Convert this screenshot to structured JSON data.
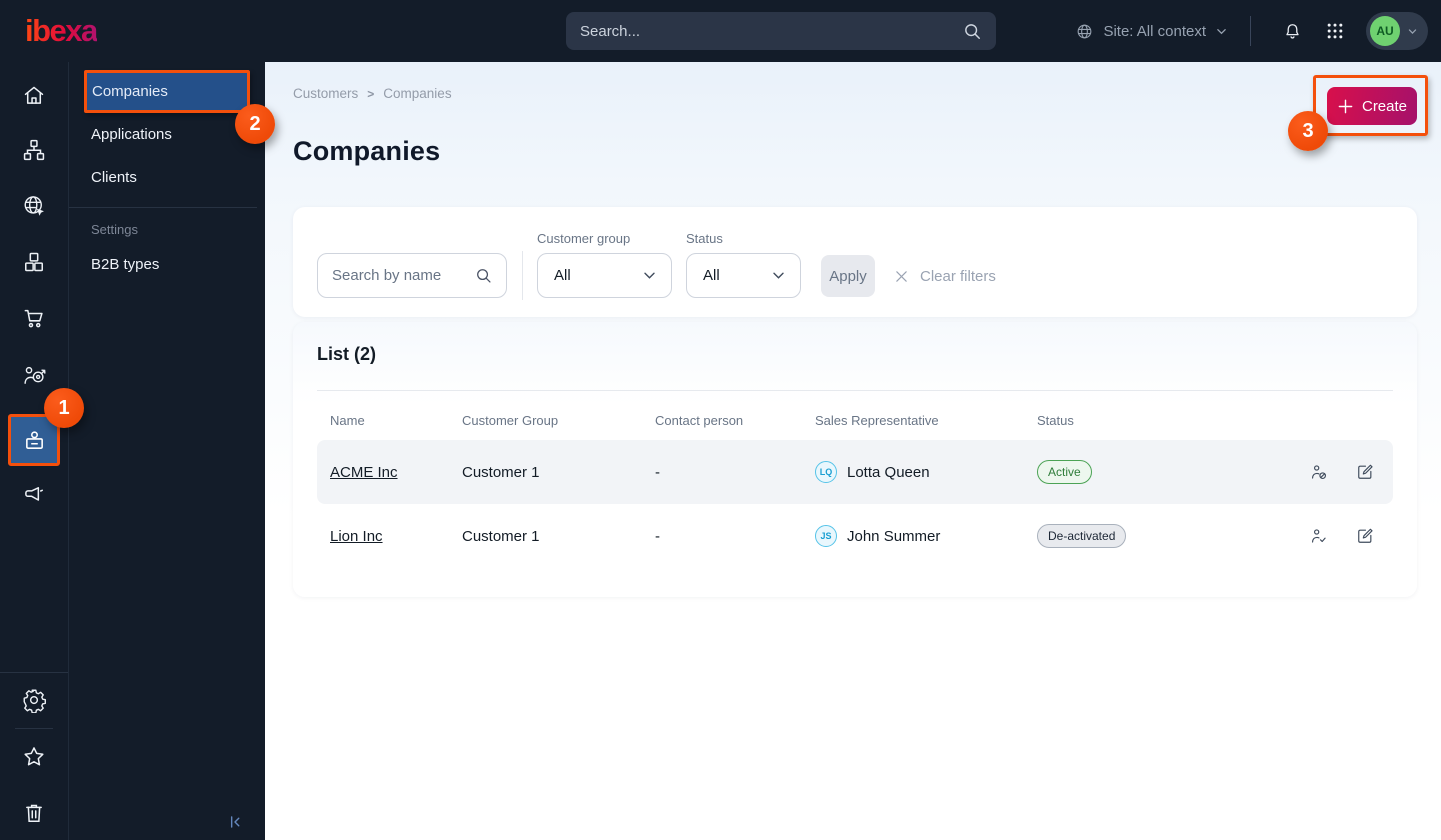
{
  "colors": {
    "topbar_bg": "#131c29",
    "annotation_orange": "#f4500c",
    "selected_menu_blue": "#24508a",
    "brand_gradient_start": "#d8104b",
    "brand_gradient_end": "#a5116b",
    "active_badge_green": "#2f7d3a",
    "avatar_green": "#6fd170"
  },
  "topbar": {
    "logo_text": "ibexa",
    "search_placeholder": "Search...",
    "site_context_label": "Site: All context",
    "avatar_initials": "AU"
  },
  "sidebar": {
    "menu_items": [
      {
        "label": "Companies"
      },
      {
        "label": "Applications"
      },
      {
        "label": "Clients"
      }
    ],
    "section_label": "Settings",
    "section_items": [
      {
        "label": "B2B types"
      }
    ]
  },
  "annotations": {
    "step1": "1",
    "step2": "2",
    "step3": "3"
  },
  "main": {
    "breadcrumb": {
      "parent": "Customers",
      "separator": ">",
      "current": "Companies"
    },
    "page_title": "Companies",
    "create_button_label": "Create",
    "filters": {
      "search_placeholder": "Search by name",
      "customer_group_label": "Customer group",
      "customer_group_value": "All",
      "status_label": "Status",
      "status_value": "All",
      "apply_label": "Apply",
      "clear_filters_label": "Clear filters"
    },
    "list": {
      "heading": "List (2)",
      "columns": [
        "Name",
        "Customer Group",
        "Contact person",
        "Sales Representative",
        "Status"
      ],
      "rows": [
        {
          "name": "ACME Inc",
          "customer_group": "Customer 1",
          "contact_person": "-",
          "sales_representative": "Lotta Queen",
          "sales_representative_initials": "LQ",
          "status": "Active"
        },
        {
          "name": "Lion Inc",
          "customer_group": "Customer 1",
          "contact_person": "-",
          "sales_representative": "John Summer",
          "sales_representative_initials": "JS",
          "status": "De-activated"
        }
      ]
    }
  }
}
